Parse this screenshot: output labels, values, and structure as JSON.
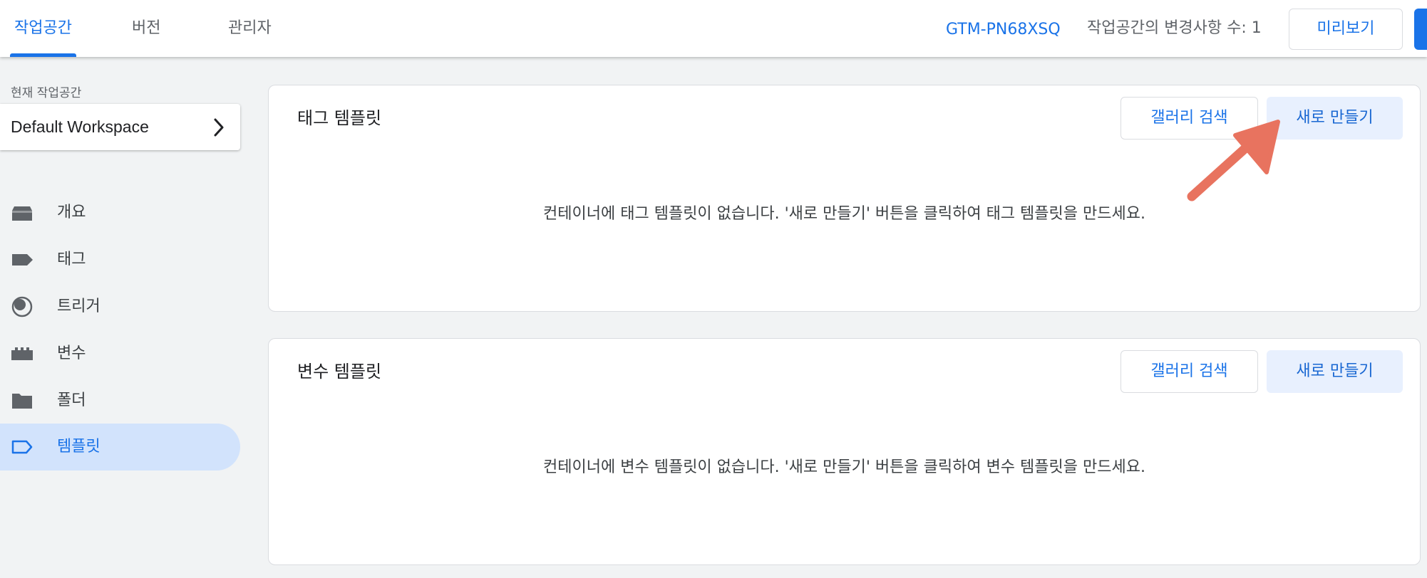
{
  "header": {
    "tabs": [
      {
        "label": "작업공간",
        "active": true
      },
      {
        "label": "버전",
        "active": false
      },
      {
        "label": "관리자",
        "active": false
      }
    ],
    "container_id": "GTM-PN68XSQ",
    "workspace_changes": "작업공간의 변경사항 수: 1",
    "preview_label": "미리보기"
  },
  "sidebar": {
    "current_workspace_label": "현재 작업공간",
    "workspace_name": "Default Workspace",
    "items": [
      {
        "label": "개요",
        "icon": "overview-icon"
      },
      {
        "label": "태그",
        "icon": "tag-icon"
      },
      {
        "label": "트리거",
        "icon": "trigger-icon"
      },
      {
        "label": "변수",
        "icon": "variables-icon"
      },
      {
        "label": "폴더",
        "icon": "folder-icon"
      },
      {
        "label": "템플릿",
        "icon": "template-icon",
        "active": true
      }
    ]
  },
  "tag_templates": {
    "title": "태그 템플릿",
    "gallery_label": "갤러리 검색",
    "new_label": "새로 만들기",
    "empty_message": "컨테이너에 태그 템플릿이 없습니다. '새로 만들기' 버튼을 클릭하여 태그 템플릿을 만드세요."
  },
  "variable_templates": {
    "title": "변수 템플릿",
    "gallery_label": "갤러리 검색",
    "new_label": "새로 만들기",
    "empty_message": "컨테이너에 변수 템플릿이 없습니다. '새로 만들기' 버튼을 클릭하여 변수 템플릿을 만드세요."
  },
  "colors": {
    "accent": "#1a73e8",
    "active_nav_bg": "#d2e3fc",
    "annotation_arrow": "#e8735f"
  }
}
